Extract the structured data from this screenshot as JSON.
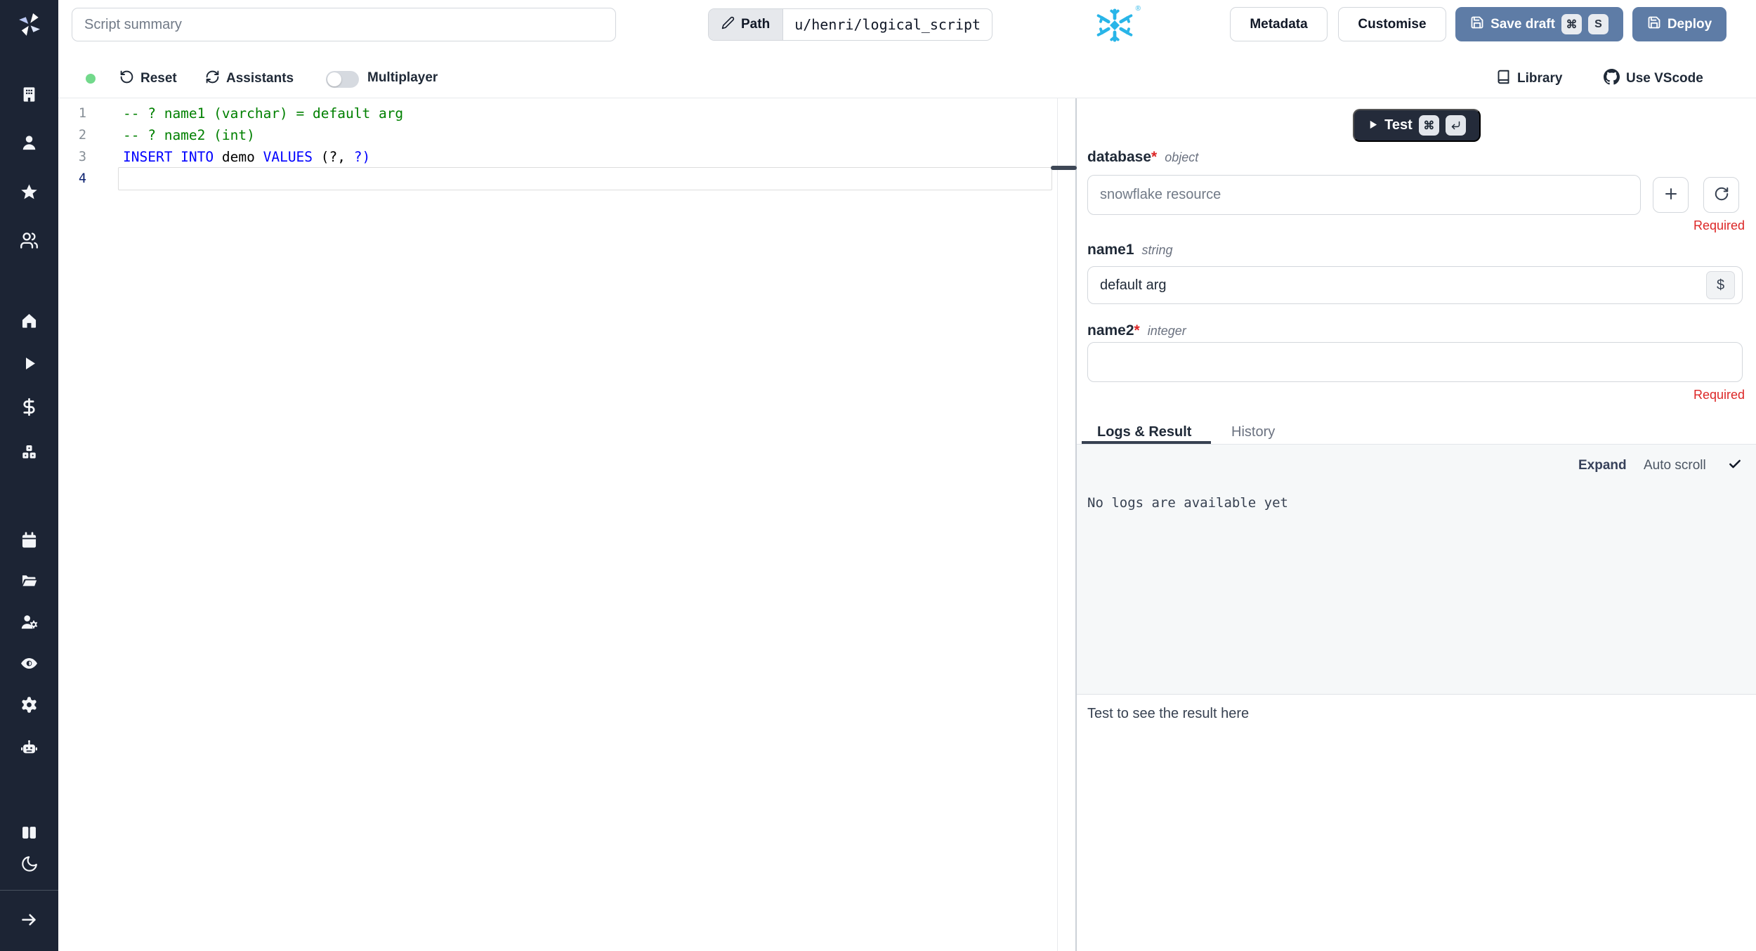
{
  "colors": {
    "sidebar_bg": "#1C2434",
    "primary_button_blue": "#5E7CA6",
    "test_button_dark": "#242B3A",
    "required_red": "#DC2626",
    "status_green": "#72D98B",
    "snowflake_blue": "#29B5E8",
    "comment_green": "#008000",
    "keyword_blue": "#0000FF"
  },
  "topbar": {
    "summary_placeholder": "Script summary",
    "path": {
      "label": "Path",
      "value": "u/henri/logical_script"
    },
    "buttons": {
      "metadata": "Metadata",
      "customise": "Customise",
      "save_draft": "Save draft",
      "deploy": "Deploy"
    },
    "kbd": {
      "cmd": "⌘",
      "s": "S"
    }
  },
  "toolbar": {
    "reset": "Reset",
    "assistants": "Assistants",
    "multiplayer": "Multiplayer",
    "library": "Library",
    "use_vscode": "Use VScode"
  },
  "editor": {
    "lines": [
      {
        "num": "1",
        "tokens": [
          {
            "t": "-- ? name1 (varchar) = default arg",
            "c": "comment"
          }
        ]
      },
      {
        "num": "2",
        "tokens": [
          {
            "t": "-- ? name2 (int)",
            "c": "comment"
          }
        ]
      },
      {
        "num": "3",
        "tokens": [
          {
            "t": "INSERT INTO",
            "c": "keyword"
          },
          {
            "t": " demo ",
            "c": "plain"
          },
          {
            "t": "VALUES",
            "c": "keyword"
          },
          {
            "t": " (?, ",
            "c": "plain"
          },
          {
            "t": "?)",
            "c": "keyword"
          }
        ]
      },
      {
        "num": "4",
        "tokens": []
      }
    ]
  },
  "panel": {
    "test": {
      "label": "Test",
      "kbd_cmd": "⌘"
    },
    "fields": [
      {
        "name": "database",
        "star": "*",
        "type": "object",
        "placeholder": "snowflake resource",
        "required_label": "Required"
      },
      {
        "name": "name1",
        "type": "string",
        "value": "default arg",
        "dollar": "$"
      },
      {
        "name": "name2",
        "star": "*",
        "type": "integer",
        "value": "",
        "required_label": "Required"
      }
    ],
    "tabs": {
      "logs": "Logs & Result",
      "history": "History"
    },
    "logs": {
      "expand": "Expand",
      "autoscroll": "Auto scroll",
      "empty": "No logs are available yet"
    },
    "result_hint": "Test to see the result here"
  },
  "sidebar": {
    "icons": [
      "windmill-logo",
      "building",
      "user",
      "star",
      "users",
      "home",
      "play",
      "dollar-sign",
      "boxes",
      "calendar",
      "folder-open",
      "user-cog",
      "eye",
      "settings-gear",
      "bot",
      "book-open",
      "moon",
      "arrow-right"
    ]
  }
}
